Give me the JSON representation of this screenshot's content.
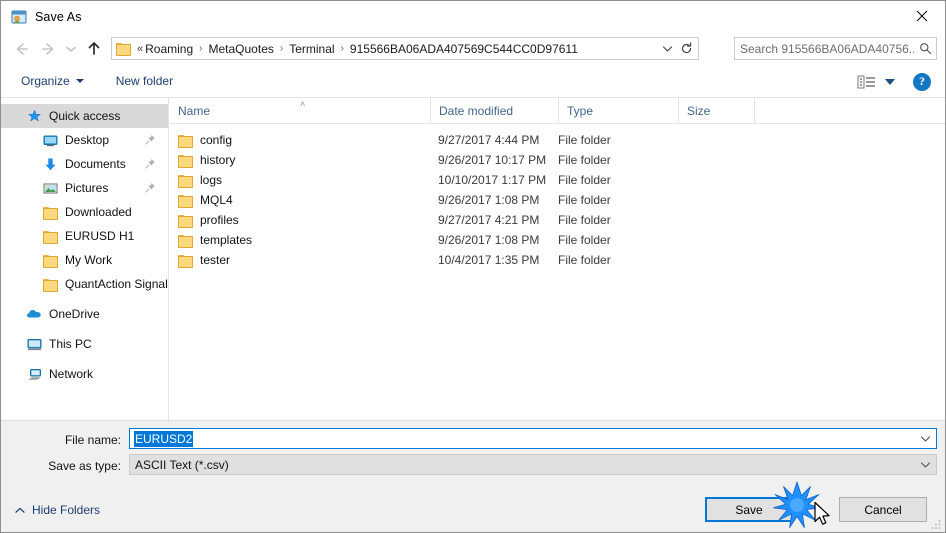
{
  "window": {
    "title": "Save As",
    "icon": "save-as-app-icon",
    "close_label": "✕"
  },
  "nav": {
    "back_icon": "arrow-left-icon",
    "forward_icon": "arrow-right-icon",
    "recent_icon": "chevron-down-icon",
    "up_icon": "arrow-up-icon",
    "refresh_icon": "refresh-icon",
    "address_chevron_icon": "chevron-down-icon"
  },
  "address": {
    "folder_icon": "folder-icon",
    "prefix": "«",
    "separator": "›",
    "crumbs": [
      "Roaming",
      "MetaQuotes",
      "Terminal",
      "915566BA06ADA407569C544CC0D97611"
    ]
  },
  "search": {
    "placeholder": "Search 915566BA06ADA40756...",
    "icon": "search-icon"
  },
  "toolbar": {
    "organize_label": "Organize",
    "new_folder_label": "New folder",
    "view_icon": "view-layout-icon",
    "view_caret_icon": "chevron-down-icon",
    "help_label": "?"
  },
  "sidebar": {
    "items": [
      {
        "label": "Quick access",
        "icon": "star-icon",
        "level": 0,
        "selected": true,
        "pinned": false
      },
      {
        "label": "Desktop",
        "icon": "desktop-icon",
        "level": 1,
        "selected": false,
        "pinned": true
      },
      {
        "label": "Documents",
        "icon": "download-arrow-icon",
        "level": 1,
        "selected": false,
        "pinned": true
      },
      {
        "label": "Pictures",
        "icon": "pictures-icon",
        "level": 1,
        "selected": false,
        "pinned": true
      },
      {
        "label": "Downloaded",
        "icon": "folder-icon",
        "level": 1,
        "selected": false,
        "pinned": false
      },
      {
        "label": "EURUSD H1",
        "icon": "folder-icon",
        "level": 1,
        "selected": false,
        "pinned": false
      },
      {
        "label": "My Work",
        "icon": "folder-icon",
        "level": 1,
        "selected": false,
        "pinned": false
      },
      {
        "label": "QuantAction Signal",
        "icon": "folder-icon",
        "level": 1,
        "selected": false,
        "pinned": false
      },
      {
        "label": "OneDrive",
        "icon": "onedrive-cloud-icon",
        "level": 0,
        "selected": false,
        "pinned": false
      },
      {
        "label": "This PC",
        "icon": "this-pc-icon",
        "level": 0,
        "selected": false,
        "pinned": false
      },
      {
        "label": "Network",
        "icon": "network-icon",
        "level": 0,
        "selected": false,
        "pinned": false
      }
    ]
  },
  "filelist": {
    "columns": [
      "Name",
      "Date modified",
      "Type",
      "Size"
    ],
    "sort_caret": "˄",
    "rows": [
      {
        "name": "config",
        "date": "9/27/2017 4:44 PM",
        "type": "File folder",
        "size": ""
      },
      {
        "name": "history",
        "date": "9/26/2017 10:17 PM",
        "type": "File folder",
        "size": ""
      },
      {
        "name": "logs",
        "date": "10/10/2017 1:17 PM",
        "type": "File folder",
        "size": ""
      },
      {
        "name": "MQL4",
        "date": "9/26/2017 1:08 PM",
        "type": "File folder",
        "size": ""
      },
      {
        "name": "profiles",
        "date": "9/27/2017 4:21 PM",
        "type": "File folder",
        "size": ""
      },
      {
        "name": "templates",
        "date": "9/26/2017 1:08 PM",
        "type": "File folder",
        "size": ""
      },
      {
        "name": "tester",
        "date": "10/4/2017 1:35 PM",
        "type": "File folder",
        "size": ""
      }
    ]
  },
  "form": {
    "filename_label": "File name:",
    "filename_value": "EURUSD2",
    "savetype_label": "Save as type:",
    "savetype_value": "ASCII Text (*.csv)",
    "chevron_icon": "chevron-down-icon"
  },
  "footer": {
    "hide_folders_label": "Hide Folders",
    "hide_folders_icon": "chevron-up-icon",
    "save_label": "Save",
    "cancel_label": "Cancel",
    "resize_grip_icon": "resize-grip-icon"
  },
  "pointer": {
    "click_effect_icon": "click-burst-icon",
    "cursor_icon": "mouse-pointer-icon"
  },
  "colors": {
    "accent": "#0078d7",
    "selection": "#0078d7",
    "header_text": "#41678f",
    "toolbar_text": "#1c3d6e",
    "burst": "#1e90ff"
  }
}
